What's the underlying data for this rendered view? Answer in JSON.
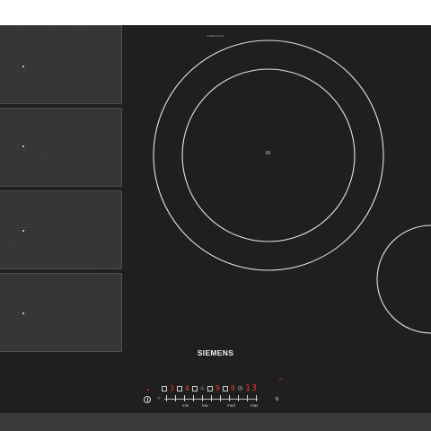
{
  "hob": {
    "model": "ED851FSC1E",
    "brand": "SIEMENS",
    "zones": [
      {
        "name": "flex-zone-1"
      },
      {
        "name": "flex-zone-2"
      },
      {
        "name": "flex-zone-3"
      },
      {
        "name": "flex-zone-4"
      }
    ],
    "large_ring_label": "IN"
  },
  "control_panel": {
    "display_left": "3",
    "display_mid1": "4",
    "display_mid2": "9",
    "display_mid3": "0",
    "timer_display": "13",
    "tiny_label": "min",
    "power_symbol": "power-icon",
    "slider_labels": [
      "min",
      "low",
      "med",
      "max"
    ],
    "minus_symbol": "○",
    "plus_symbol": "b"
  }
}
